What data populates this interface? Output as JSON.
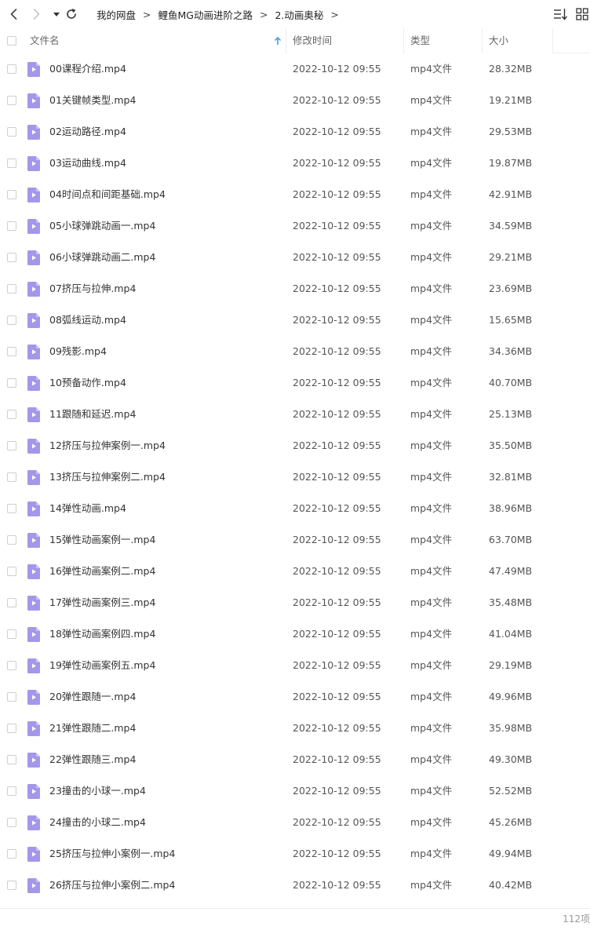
{
  "breadcrumb": [
    "我的网盘",
    "鲤鱼MG动画进阶之路",
    "2.动画奥秘"
  ],
  "breadcrumb_separator": ">",
  "columns": {
    "name": "文件名",
    "modified": "修改时间",
    "type": "类型",
    "size": "大小"
  },
  "colors": {
    "accent": "#2f9cf0",
    "file_icon": "#a397ea"
  },
  "files": [
    {
      "name": "00课程介绍.mp4",
      "modified": "2022-10-12 09:55",
      "type": "mp4文件",
      "size": "28.32MB"
    },
    {
      "name": "01关键帧类型.mp4",
      "modified": "2022-10-12 09:55",
      "type": "mp4文件",
      "size": "19.21MB"
    },
    {
      "name": "02运动路径.mp4",
      "modified": "2022-10-12 09:55",
      "type": "mp4文件",
      "size": "29.53MB"
    },
    {
      "name": "03运动曲线.mp4",
      "modified": "2022-10-12 09:55",
      "type": "mp4文件",
      "size": "19.87MB"
    },
    {
      "name": "04时间点和间距基础.mp4",
      "modified": "2022-10-12 09:55",
      "type": "mp4文件",
      "size": "42.91MB"
    },
    {
      "name": "05小球弹跳动画一.mp4",
      "modified": "2022-10-12 09:55",
      "type": "mp4文件",
      "size": "34.59MB"
    },
    {
      "name": "06小球弹跳动画二.mp4",
      "modified": "2022-10-12 09:55",
      "type": "mp4文件",
      "size": "29.21MB"
    },
    {
      "name": "07挤压与拉伸.mp4",
      "modified": "2022-10-12 09:55",
      "type": "mp4文件",
      "size": "23.69MB"
    },
    {
      "name": "08弧线运动.mp4",
      "modified": "2022-10-12 09:55",
      "type": "mp4文件",
      "size": "15.65MB"
    },
    {
      "name": "09残影.mp4",
      "modified": "2022-10-12 09:55",
      "type": "mp4文件",
      "size": "34.36MB"
    },
    {
      "name": "10预备动作.mp4",
      "modified": "2022-10-12 09:55",
      "type": "mp4文件",
      "size": "40.70MB"
    },
    {
      "name": "11跟随和延迟.mp4",
      "modified": "2022-10-12 09:55",
      "type": "mp4文件",
      "size": "25.13MB"
    },
    {
      "name": "12挤压与拉伸案例一.mp4",
      "modified": "2022-10-12 09:55",
      "type": "mp4文件",
      "size": "35.50MB"
    },
    {
      "name": "13挤压与拉伸案例二.mp4",
      "modified": "2022-10-12 09:55",
      "type": "mp4文件",
      "size": "32.81MB"
    },
    {
      "name": "14弹性动画.mp4",
      "modified": "2022-10-12 09:55",
      "type": "mp4文件",
      "size": "38.96MB"
    },
    {
      "name": "15弹性动画案例一.mp4",
      "modified": "2022-10-12 09:55",
      "type": "mp4文件",
      "size": "63.70MB"
    },
    {
      "name": "16弹性动画案例二.mp4",
      "modified": "2022-10-12 09:55",
      "type": "mp4文件",
      "size": "47.49MB"
    },
    {
      "name": "17弹性动画案例三.mp4",
      "modified": "2022-10-12 09:55",
      "type": "mp4文件",
      "size": "35.48MB"
    },
    {
      "name": "18弹性动画案例四.mp4",
      "modified": "2022-10-12 09:55",
      "type": "mp4文件",
      "size": "41.04MB"
    },
    {
      "name": "19弹性动画案例五.mp4",
      "modified": "2022-10-12 09:55",
      "type": "mp4文件",
      "size": "29.19MB"
    },
    {
      "name": "20弹性跟随一.mp4",
      "modified": "2022-10-12 09:55",
      "type": "mp4文件",
      "size": "49.96MB"
    },
    {
      "name": "21弹性跟随二.mp4",
      "modified": "2022-10-12 09:55",
      "type": "mp4文件",
      "size": "35.98MB"
    },
    {
      "name": "22弹性跟随三.mp4",
      "modified": "2022-10-12 09:55",
      "type": "mp4文件",
      "size": "49.30MB"
    },
    {
      "name": "23撞击的小球一.mp4",
      "modified": "2022-10-12 09:55",
      "type": "mp4文件",
      "size": "52.52MB"
    },
    {
      "name": "24撞击的小球二.mp4",
      "modified": "2022-10-12 09:55",
      "type": "mp4文件",
      "size": "45.26MB"
    },
    {
      "name": "25挤压与拉伸小案例一.mp4",
      "modified": "2022-10-12 09:55",
      "type": "mp4文件",
      "size": "49.94MB"
    },
    {
      "name": "26挤压与拉伸小案例二.mp4",
      "modified": "2022-10-12 09:55",
      "type": "mp4文件",
      "size": "40.42MB"
    }
  ],
  "footer": {
    "count": "112项"
  },
  "icons": {
    "back": "chevron-left-icon",
    "forward": "chevron-right-icon",
    "history": "caret-down-icon",
    "refresh": "refresh-icon",
    "sort_asc": "arrow-up-icon",
    "sort_menu": "sort-list-icon",
    "grid_view": "grid-view-icon",
    "file": "video-file-icon"
  }
}
